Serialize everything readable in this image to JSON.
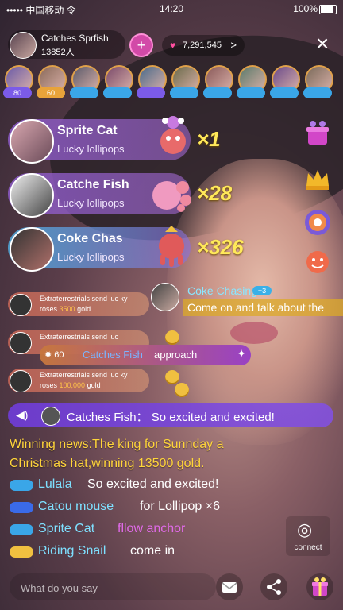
{
  "status_bar": {
    "carrier": "••••• 中国移动 令",
    "time": "14:20",
    "battery": "100%"
  },
  "host": {
    "name": "Catches Sprfish",
    "count": "13852人"
  },
  "coins": {
    "value": "7,291,545",
    "chevron": ">"
  },
  "follow": {
    "label": "+"
  },
  "close": {
    "label": "×"
  },
  "viewers": [
    {
      "level": "80",
      "badge_color": "#7b5be8"
    },
    {
      "level": "60",
      "badge_color": "#e8a33a"
    },
    {
      "level": "",
      "badge_color": "#3aa6e8"
    },
    {
      "level": "",
      "badge_color": "#3aa6e8"
    },
    {
      "level": "",
      "badge_color": "#7b5be8"
    },
    {
      "level": "",
      "badge_color": "#3aa6e8"
    },
    {
      "level": "",
      "badge_color": "#3aa6e8"
    },
    {
      "level": "",
      "badge_color": "#3aa6e8"
    },
    {
      "level": "",
      "badge_color": "#3aa6e8"
    },
    {
      "level": "",
      "badge_color": "#3aa6e8"
    }
  ],
  "gifts": [
    {
      "name": "Sprite Cat",
      "gift": "Lucky lollipops",
      "multiplier": "×1"
    },
    {
      "name": "Catche Fish",
      "gift": "Lucky lollipops",
      "multiplier": "×28"
    },
    {
      "name": "Coke Chas",
      "gift": "Lucky lollipops",
      "multiplier": "×326"
    }
  ],
  "notices": [
    {
      "text_a": "Extraterrestrials send luc ky roses",
      "amount": "3500",
      "unit": "gold"
    },
    {
      "text_a": "Extraterrestrials send luc",
      "amount": "",
      "unit": ""
    },
    {
      "text_a": "Extraterrestrials send luc ky roses",
      "amount": "100,000",
      "unit": "gold"
    }
  ],
  "chat_user": {
    "name": "Coke Chasing",
    "level": "+3",
    "message": "Come on and talk about the"
  },
  "approach": {
    "level": "60",
    "name": "Catches Fish",
    "text": "approach"
  },
  "banner": {
    "name": "Catches Fish",
    "colon": "：",
    "text": "So excited and excited!"
  },
  "winning": {
    "text": "Winning news:The king for Sunnday a Christmas hat,winning 13500 gold."
  },
  "messages": [
    {
      "name": "Lulala",
      "text": "So excited and excited!",
      "name_color": "#7ee0ff",
      "badge_color": "#3aa6e8"
    },
    {
      "name": "Catou mouse",
      "text": "for Lollipop ×6",
      "name_color": "#7ee0ff",
      "badge_color": "#3a6ae8"
    },
    {
      "name": "Sprite Cat",
      "text": "fllow anchor",
      "name_color": "#7ee0ff",
      "text_color": "#e06ae8",
      "badge_color": "#3aa6e8"
    },
    {
      "name": "Riding Snail",
      "text": "come in",
      "name_color": "#7ee0ff",
      "badge_color": "#f0c040"
    }
  ],
  "connect": {
    "label": "connect"
  },
  "input": {
    "placeholder": "What do you say"
  },
  "icons": {
    "mail": "mail-icon",
    "share": "share-icon",
    "gift": "gift-box-icon"
  }
}
